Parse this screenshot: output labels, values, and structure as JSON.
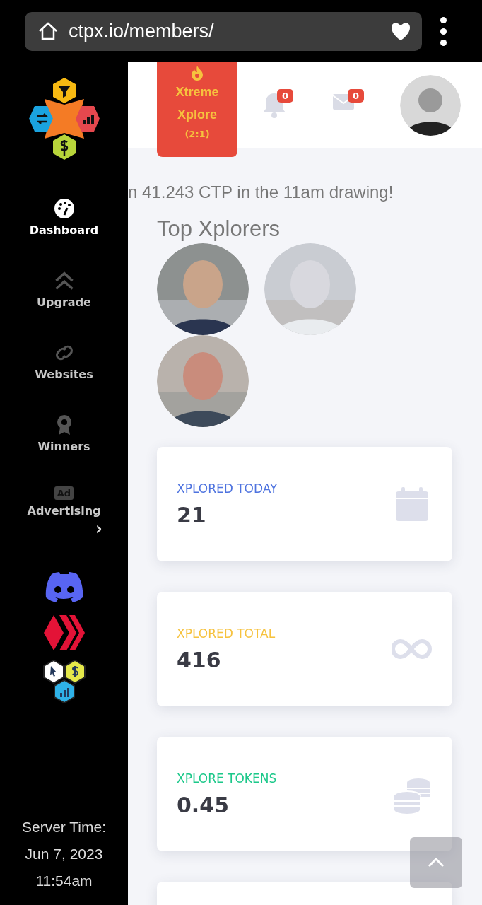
{
  "browser": {
    "url": "ctpx.io/members/"
  },
  "sidebar": {
    "items": [
      {
        "kind": "dashboard",
        "label": "Dashboard",
        "selected": true
      },
      {
        "kind": "upgrade",
        "label": "Upgrade",
        "selected": false
      },
      {
        "kind": "websites",
        "label": "Websites",
        "selected": false
      },
      {
        "kind": "winners",
        "label": "Winners",
        "selected": false
      },
      {
        "kind": "advertising",
        "label": "Advertising",
        "selected": false,
        "icon_text": "Ad",
        "expander": "›"
      }
    ],
    "server_time": {
      "label": "Server Time:",
      "date": "Jun 7, 2023",
      "time": "11:54am"
    }
  },
  "header": {
    "promo": {
      "title": "Xtreme Xplore",
      "ratio": "(2:1)"
    },
    "notifications": "0",
    "messages": "0"
  },
  "ticker": "n 41.243 CTP in the 11am drawing!",
  "top_xplorers": {
    "title": "Top Xplorers"
  },
  "stats": [
    {
      "kind": "today",
      "label": "XPLORED TODAY",
      "value": "21",
      "color": "#4e73df"
    },
    {
      "kind": "total",
      "label": "XPLORED TOTAL",
      "value": "416",
      "color": "#f6c23e"
    },
    {
      "kind": "tokens",
      "label": "XPLORE TOKENS",
      "value": "0.45",
      "color": "#1cc88a"
    }
  ]
}
